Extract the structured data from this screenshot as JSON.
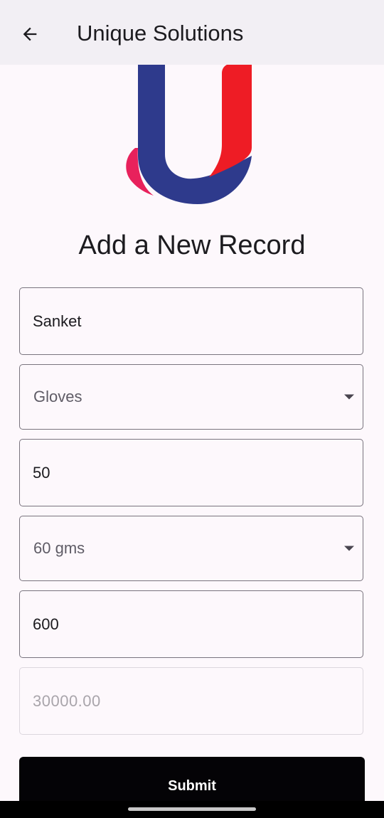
{
  "appbar": {
    "title": "Unique Solutions",
    "back_icon": "arrow-left-icon"
  },
  "logo": {
    "icon": "unique-solutions-u-logo",
    "colors": {
      "blue": "#2e3a8c",
      "red": "#ee1c25",
      "pink": "#e8215c"
    }
  },
  "form": {
    "title": "Add a New Record",
    "name_value": "Sanket",
    "product_value": "Gloves",
    "quantity_value": "50",
    "weight_value": "60 gms",
    "rate_value": "600",
    "total_value": "30000.00",
    "submit_label": "Submit"
  },
  "colors": {
    "background": "#fdf8fc",
    "appbar": "#f2eff4",
    "field_border": "#79747e",
    "button": "#040306"
  }
}
